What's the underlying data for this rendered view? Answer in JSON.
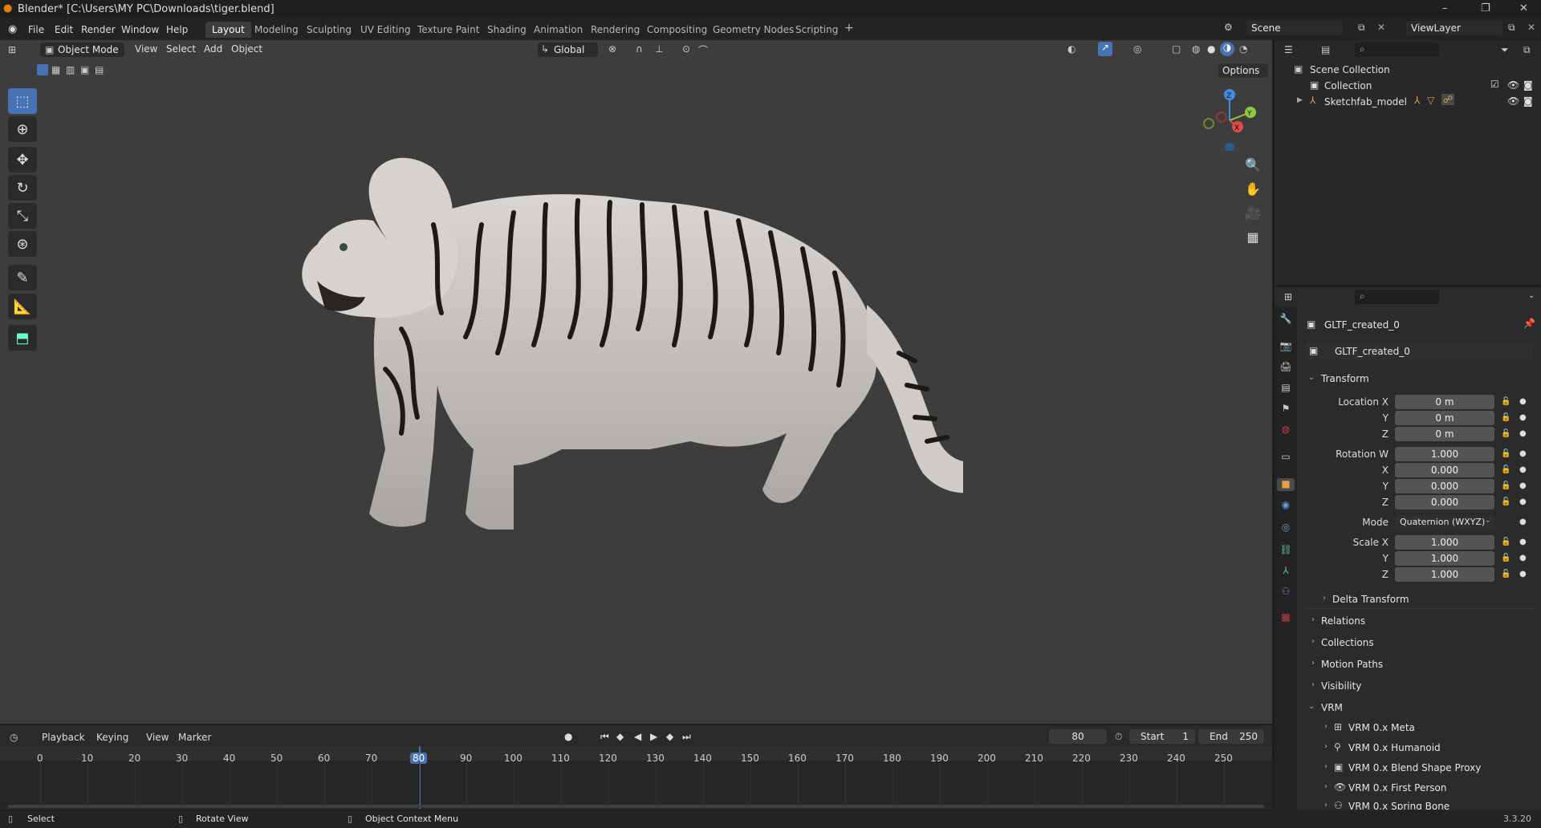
{
  "window": {
    "title": "Blender* [C:\\Users\\MY PC\\Downloads\\tiger.blend]",
    "minimize": "–",
    "maximize": "❐",
    "close": "✕"
  },
  "menu": [
    "File",
    "Edit",
    "Render",
    "Window",
    "Help"
  ],
  "workspaces": {
    "active": "Layout",
    "tabs": [
      "Modeling",
      "Sculpting",
      "UV Editing",
      "Texture Paint",
      "Shading",
      "Animation",
      "Rendering",
      "Compositing",
      "Geometry Nodes",
      "Scripting"
    ],
    "add": "+"
  },
  "scene": {
    "name": "Scene",
    "view_layer": "ViewLayer"
  },
  "viewport": {
    "mode": "Object Mode",
    "menus": [
      "View",
      "Select",
      "Add",
      "Object"
    ],
    "orientation": "Global",
    "options": "Options",
    "gizmo_axes": [
      "Z",
      "Y",
      "X"
    ]
  },
  "outliner": {
    "root": "Scene Collection",
    "collection": "Collection",
    "object": "Sketchfab_model"
  },
  "properties": {
    "object_name": "GLTF_created_0",
    "data_name": "GLTF_created_0",
    "transform_title": "Transform",
    "location": {
      "label": "Location X",
      "x": "0 m",
      "y": "0 m",
      "z": "0 m"
    },
    "rotation": {
      "label": "Rotation W",
      "w": "1.000",
      "x": "0.000",
      "y": "0.000",
      "z": "0.000"
    },
    "mode_label": "Mode",
    "mode_value": "Quaternion (WXYZ)",
    "scale": {
      "label": "Scale X",
      "x": "1.000",
      "y": "1.000",
      "z": "1.000"
    },
    "axis_y": "Y",
    "axis_z": "Z",
    "axis_x": "X",
    "delta": "Delta Transform",
    "sections": [
      "Relations",
      "Collections",
      "Motion Paths",
      "Visibility"
    ],
    "vrm": "VRM",
    "vrm_items": [
      "VRM 0.x Meta",
      "VRM 0.x Humanoid",
      "VRM 0.x Blend Shape Proxy",
      "VRM 0.x First Person",
      "VRM 0.x Spring Bone"
    ]
  },
  "timeline": {
    "menus": [
      "Playback",
      "Keying",
      "View",
      "Marker"
    ],
    "current_frame": "80",
    "start_label": "Start",
    "start": "1",
    "end_label": "End",
    "end": "250",
    "ticks": [
      "0",
      "10",
      "20",
      "30",
      "40",
      "50",
      "60",
      "70",
      "80",
      "90",
      "100",
      "110",
      "120",
      "130",
      "140",
      "150",
      "160",
      "170",
      "180",
      "190",
      "200",
      "210",
      "220",
      "230",
      "240",
      "250"
    ]
  },
  "status": {
    "select": "Select",
    "rotate": "Rotate View",
    "context": "Object Context Menu",
    "version": "3.3.20"
  }
}
